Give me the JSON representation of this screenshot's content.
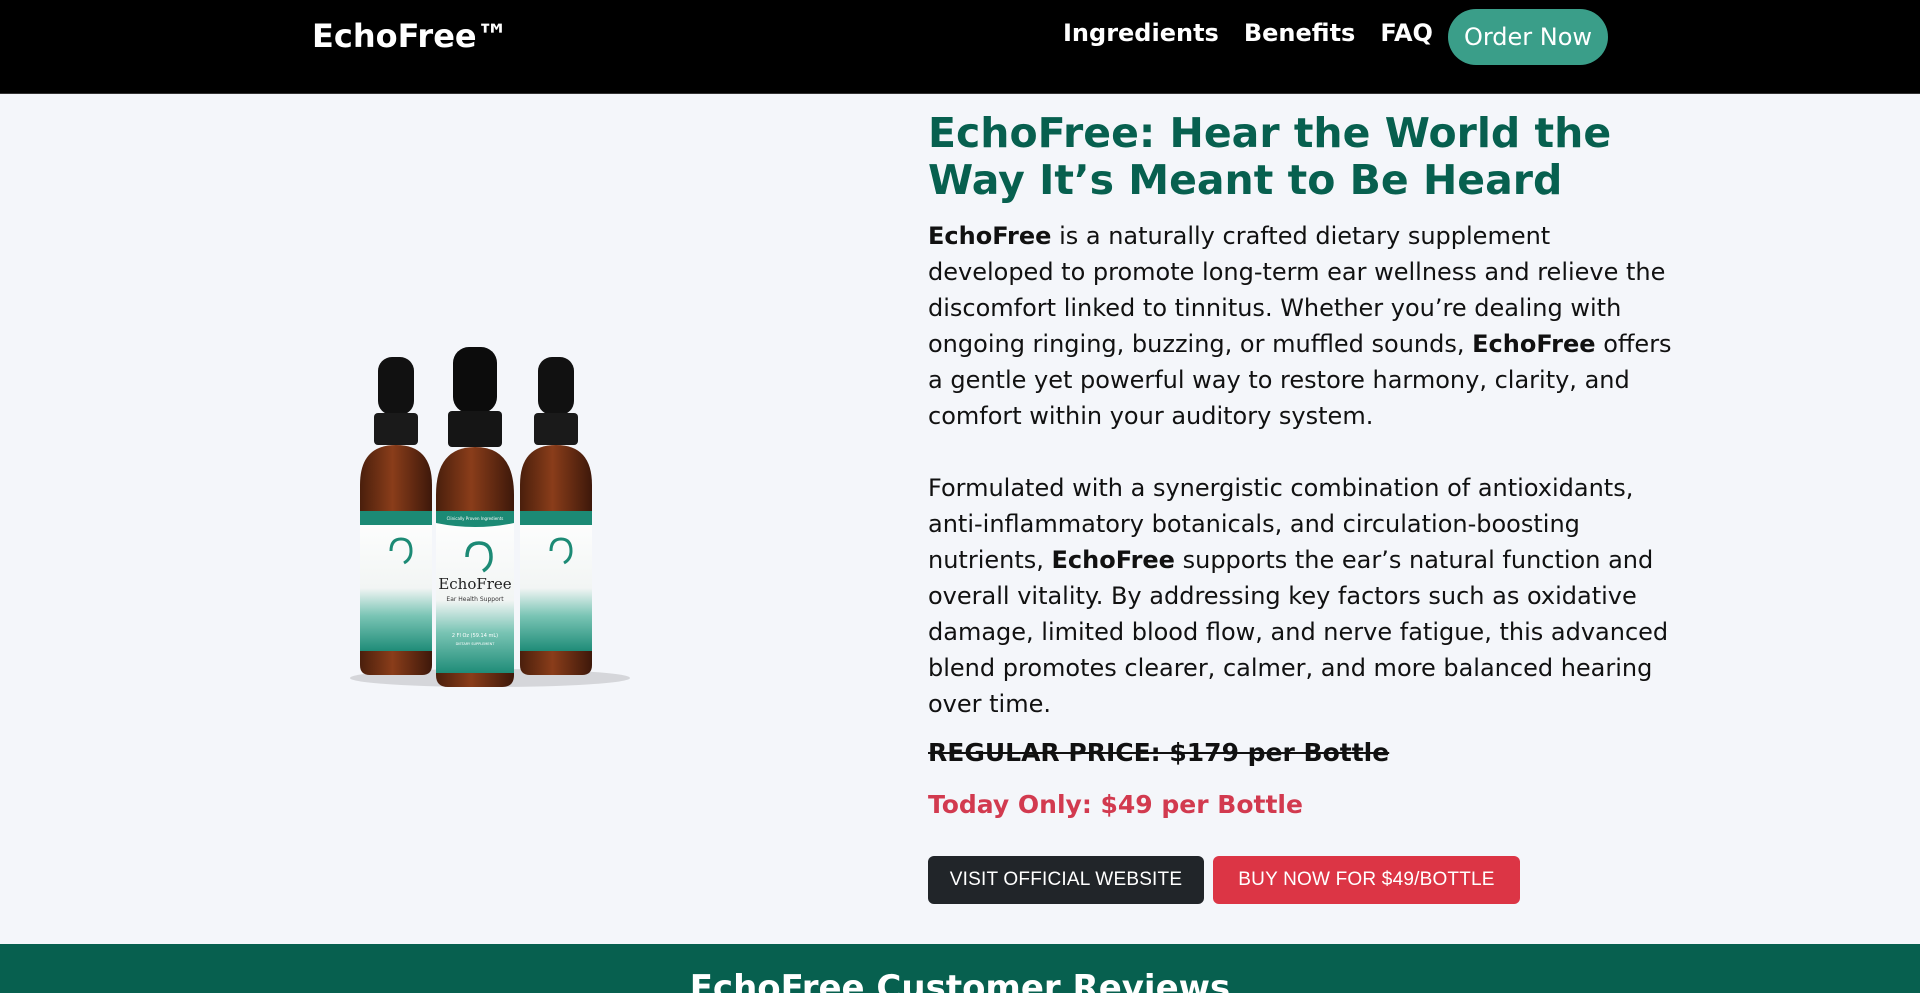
{
  "header": {
    "brand": "EchoFree™",
    "nav": [
      "Ingredients",
      "Benefits",
      "FAQ"
    ],
    "order_label": "Order Now"
  },
  "product_image": {
    "bottle_brand": "EchoFree",
    "bottle_subtitle": "Ear Health Support",
    "bottle_banner": "Clinically Proven Ingredients",
    "bottle_volume": "2 Fl Oz (59.14 mL)",
    "bottle_type": "DIETARY SUPPLEMENT"
  },
  "hero": {
    "headline": "EchoFree: Hear the World the Way It’s Meant to Be Heard",
    "para1_b1": "EchoFree",
    "para1_t1": " is a naturally crafted dietary supplement developed to promote long-term ear wellness and relieve the discomfort linked to tinnitus. Whether you’re dealing with ongoing ringing, buzzing, or muffled sounds, ",
    "para1_b2": "EchoFree",
    "para1_t2": " offers a gentle yet powerful way to restore harmony, clarity, and comfort within your auditory system.",
    "para2_t1": "Formulated with a synergistic combination of antioxidants, anti-inflammatory botanicals, and circulation-boosting nutrients, ",
    "para2_b1": "EchoFree",
    "para2_t2": " supports the ear’s natural function and overall vitality. By addressing key factors such as oxidative damage, limited blood flow, and nerve fatigue, this advanced blend promotes clearer, calmer, and more balanced hearing over time.",
    "regular_price": "REGULAR PRICE: $179 per Bottle",
    "today_price": "Today Only: $49 per Bottle",
    "visit_label": "VISIT OFFICIAL WEBSITE",
    "buy_label": "BUY NOW FOR $49/BOTTLE"
  },
  "reviews": {
    "title": "EchoFree Customer Reviews"
  },
  "colors": {
    "accent_green": "#07604f",
    "order_button": "#3a9e89",
    "price_red": "#d23a4f",
    "buy_button": "#dc3545",
    "dark_button": "#212529"
  }
}
